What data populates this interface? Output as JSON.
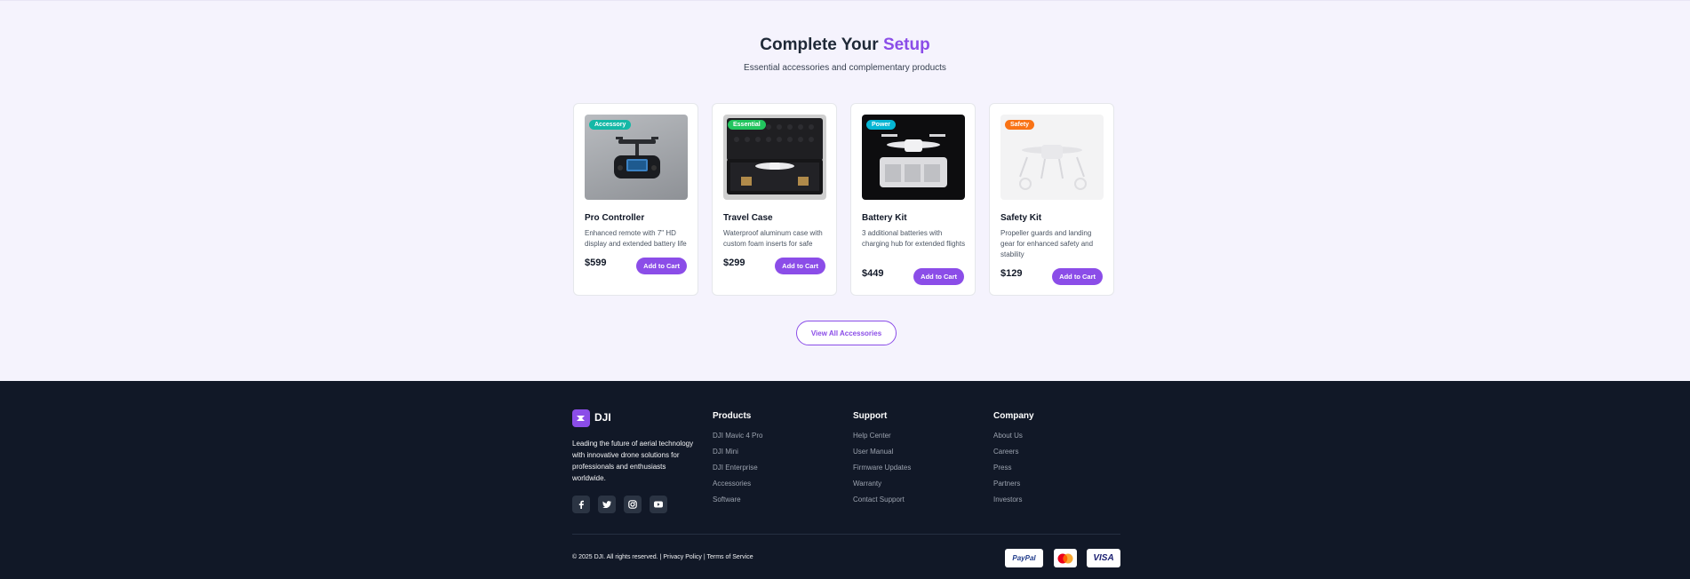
{
  "setup": {
    "title_main": "Complete Your",
    "title_accent": "Setup",
    "subtitle": "Essential accessories and complementary products",
    "view_all_label": "View All Accessories"
  },
  "products": [
    {
      "badge": "Accessory",
      "badge_color": "#14b8a6",
      "name": "Pro Controller",
      "desc": "Enhanced remote with 7\" HD display and extended battery life",
      "price": "$599",
      "cta": "Add to Cart"
    },
    {
      "badge": "Essential",
      "badge_color": "#22c55e",
      "name": "Travel Case",
      "desc": "Waterproof aluminum case with custom foam inserts for safe",
      "price": "$299",
      "cta": "Add to Cart"
    },
    {
      "badge": "Power",
      "badge_color": "#06b6d4",
      "name": "Battery Kit",
      "desc": "3 additional batteries with charging hub for extended flights",
      "price": "$449",
      "cta": "Add to Cart"
    },
    {
      "badge": "Safety",
      "badge_color": "#f97316",
      "name": "Safety Kit",
      "desc": "Propeller guards and landing gear for enhanced safety and stability",
      "price": "$129",
      "cta": "Add to Cart"
    }
  ],
  "footer": {
    "brand": "DJI",
    "tagline": "Leading the future of aerial technology with innovative drone solutions for professionals and enthusiasts worldwide.",
    "socials": [
      "facebook-icon",
      "twitter-icon",
      "instagram-icon",
      "youtube-icon"
    ],
    "columns": [
      {
        "title": "Products",
        "links": [
          "DJI Mavic 4 Pro",
          "DJI Mini",
          "DJI Enterprise",
          "Accessories",
          "Software"
        ]
      },
      {
        "title": "Support",
        "links": [
          "Help Center",
          "User Manual",
          "Firmware Updates",
          "Warranty",
          "Contact Support"
        ]
      },
      {
        "title": "Company",
        "links": [
          "About Us",
          "Careers",
          "Press",
          "Partners",
          "Investors"
        ]
      }
    ],
    "copyright": "© 2025 DJI. All rights reserved.",
    "privacy": "Privacy Policy",
    "terms": "Terms of Service",
    "payments": {
      "paypal": "PayPal",
      "mastercard": "mastercard-icon",
      "visa": "VISA"
    }
  },
  "colors": {
    "accent": "#8b4de8",
    "footer_bg": "#111827",
    "section_bg": "#f5f3fd"
  }
}
